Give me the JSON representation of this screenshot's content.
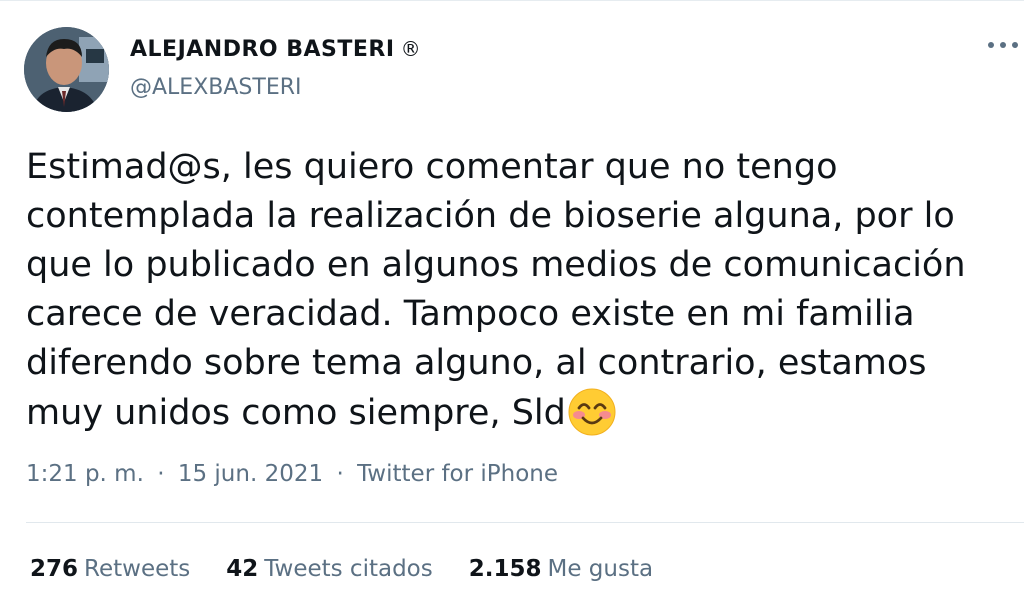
{
  "author": {
    "name": "ALEJANDRO BASTERI",
    "registered_mark": "®",
    "handle": "@ALEXBASTERI"
  },
  "tweet": {
    "lines": [
      "Estimad@s, les quiero comentar que no tengo",
      "contemplada la realización de bioserie alguna, por lo",
      "que lo publicado en algunos medios de comunicación",
      "carece de veracidad. Tampoco existe en mi familia",
      "diferendo sobre tema alguno, al contrario, estamos",
      "muy unidos como siempre, Sld"
    ],
    "emoji": "smiling-face-with-smiling-eyes"
  },
  "meta": {
    "time": "1:21 p. m.",
    "separator": "·",
    "date": "15 jun. 2021",
    "source": "Twitter for iPhone"
  },
  "stats": {
    "retweets": {
      "count": "276",
      "label": "Retweets"
    },
    "quotes": {
      "count": "42",
      "label": "Tweets citados"
    },
    "likes": {
      "count": "2.158",
      "label": "Me gusta"
    }
  },
  "colors": {
    "text": "#0f1419",
    "secondary": "#5b7083",
    "divider": "#e1e8ed"
  }
}
